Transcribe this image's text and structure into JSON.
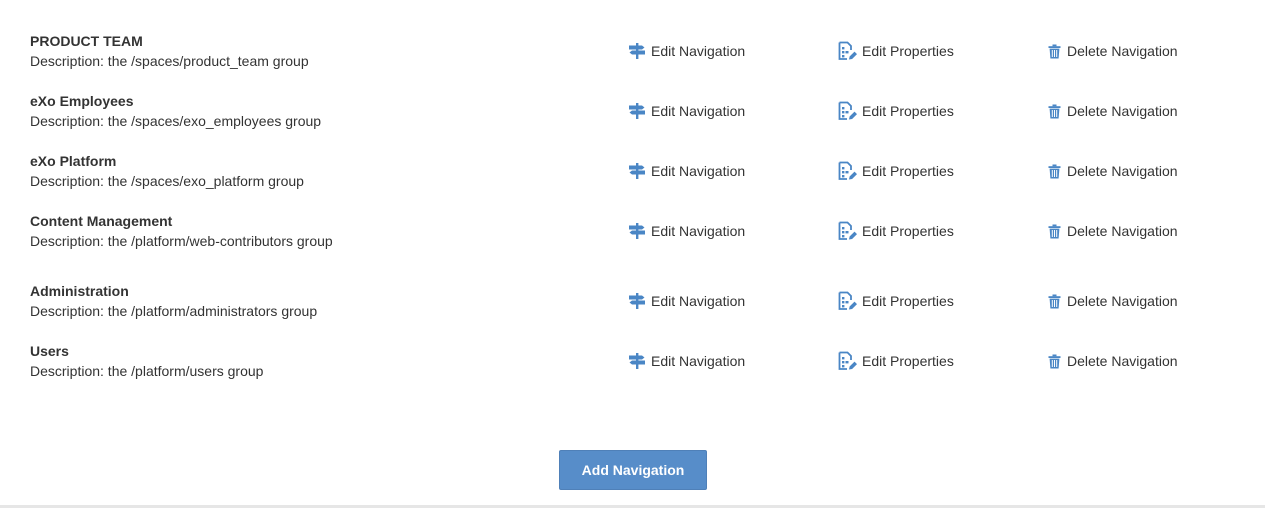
{
  "groups": [
    {
      "name": "PRODUCT TEAM",
      "description": "Description: the /spaces/product_team group"
    },
    {
      "name": "eXo Employees",
      "description": "Description: the /spaces/exo_employees group"
    },
    {
      "name": "eXo Platform",
      "description": "Description: the /spaces/exo_platform group"
    },
    {
      "name": "Content Management",
      "description": "Description: the /platform/web-contributors group"
    },
    {
      "name": "Administration",
      "description": "Description: the /platform/administrators group"
    },
    {
      "name": "Users",
      "description": "Description: the /platform/users group"
    }
  ],
  "actions": {
    "edit_navigation": "Edit Navigation",
    "edit_properties": "Edit Properties",
    "delete_navigation": "Delete Navigation"
  },
  "icons": {
    "edit_navigation": "signpost-icon",
    "edit_properties": "edit-properties-icon",
    "delete_navigation": "trash-icon"
  },
  "add_navigation_label": "Add Navigation",
  "colors": {
    "accent": "#578dc9",
    "icon": "#4a86c5",
    "text": "#333333"
  }
}
